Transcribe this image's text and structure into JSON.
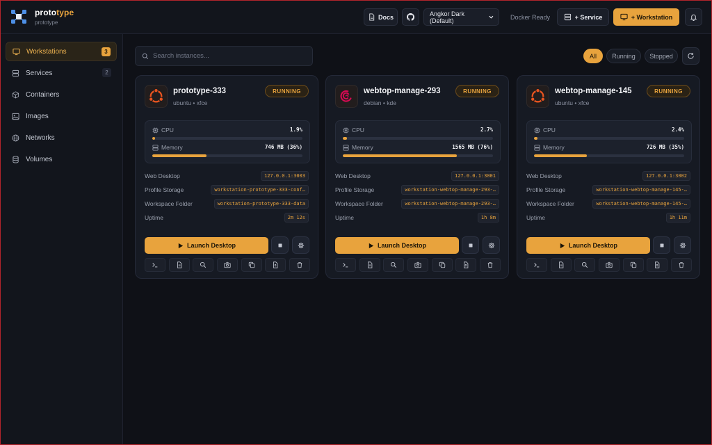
{
  "brand": {
    "title_main": "proto",
    "title_accent": "type",
    "subtitle": "prototype",
    "logo_icon": "network-nodes-icon"
  },
  "header": {
    "docs_label": "Docs",
    "github_icon": "github-icon",
    "theme_value": "Angkor Dark (Default)",
    "docker_status": "Docker Ready",
    "service_label": "+ Service",
    "workstation_label": "+ Workstation",
    "notification_icon": "bell-icon"
  },
  "sidebar": {
    "items": [
      {
        "label": "Workstations",
        "icon": "monitor-icon",
        "badge": "3",
        "active": true
      },
      {
        "label": "Services",
        "icon": "server-icon",
        "badge": "2",
        "active": false
      },
      {
        "label": "Containers",
        "icon": "cube-icon",
        "badge": "",
        "active": false
      },
      {
        "label": "Images",
        "icon": "image-icon",
        "badge": "",
        "active": false
      },
      {
        "label": "Networks",
        "icon": "globe-icon",
        "badge": "",
        "active": false
      },
      {
        "label": "Volumes",
        "icon": "database-icon",
        "badge": "",
        "active": false
      }
    ]
  },
  "toolbar": {
    "search_placeholder": "Search instances...",
    "filters": [
      "All",
      "Running",
      "Stopped"
    ],
    "active_filter": "All"
  },
  "labels": {
    "cpu": "CPU",
    "memory": "Memory",
    "web_desktop": "Web Desktop",
    "profile_storage": "Profile Storage",
    "workspace_folder": "Workspace Folder",
    "uptime": "Uptime",
    "launch": "Launch Desktop"
  },
  "cards": [
    {
      "name": "prototype-333",
      "os": "ubuntu",
      "desktop": "xfce",
      "logo": "ubuntu-logo-icon",
      "status": "RUNNING",
      "cpu_value": "1.9%",
      "cpu_fraction": 0.019,
      "memory_value": "746 MB (36%)",
      "memory_fraction": 0.36,
      "web_desktop": "127.0.0.1:3003",
      "profile_storage": "workstation-prototype-333-conf…",
      "workspace_folder": "workstation-prototype-333-data",
      "uptime": "2m 12s"
    },
    {
      "name": "webtop-manage-293",
      "os": "debian",
      "desktop": "kde",
      "logo": "debian-logo-icon",
      "status": "RUNNING",
      "cpu_value": "2.7%",
      "cpu_fraction": 0.027,
      "memory_value": "1565 MB (76%)",
      "memory_fraction": 0.76,
      "web_desktop": "127.0.0.1:3001",
      "profile_storage": "workstation-webtop-manage-293-…",
      "workspace_folder": "workstation-webtop-manage-293-…",
      "uptime": "1h 8m"
    },
    {
      "name": "webtop-manage-145",
      "os": "ubuntu",
      "desktop": "xfce",
      "logo": "ubuntu-logo-icon",
      "status": "RUNNING",
      "cpu_value": "2.4%",
      "cpu_fraction": 0.024,
      "memory_value": "726 MB (35%)",
      "memory_fraction": 0.35,
      "web_desktop": "127.0.0.1:3002",
      "profile_storage": "workstation-webtop-manage-145-…",
      "workspace_folder": "workstation-webtop-manage-145-…",
      "uptime": "1h 11m"
    }
  ],
  "card_tools": [
    "terminal-icon",
    "logs-icon",
    "inspect-icon",
    "snapshot-icon",
    "clone-icon",
    "export-icon",
    "delete-icon"
  ],
  "colors": {
    "accent": "#e8a33d",
    "background": "#0f1117",
    "panel": "#161a23",
    "ubuntu": "#e95420",
    "debian": "#d70a53"
  }
}
